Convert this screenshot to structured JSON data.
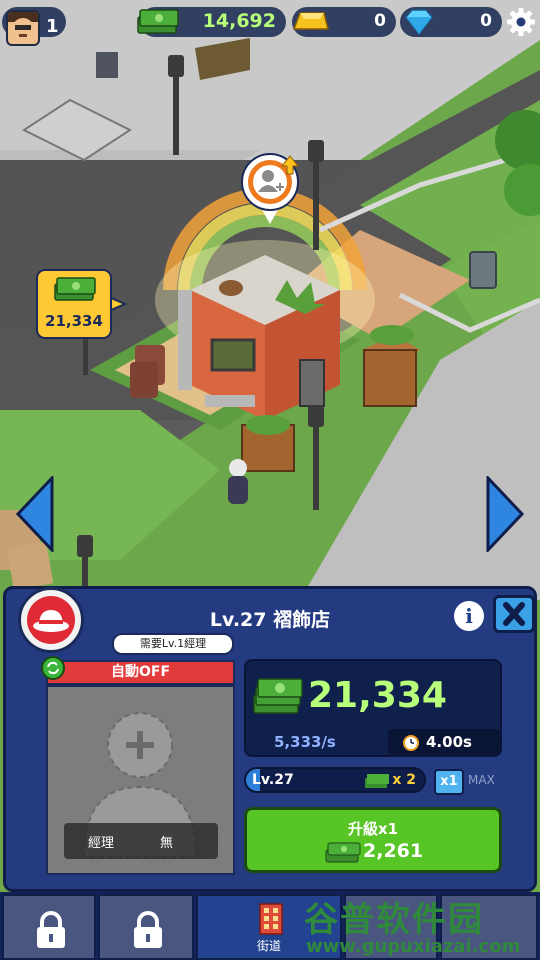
{
  "hud": {
    "player_level": "1",
    "cash": "14,692",
    "gold": "0",
    "diamonds": "0"
  },
  "scene": {
    "building_bubble_amount": "21,334"
  },
  "panel": {
    "title": "Lv.27 褶飾店",
    "manager_requirement": "需要Lv.1經理",
    "auto_status": "自動OFF",
    "manager_label": "經理",
    "manager_value": "無",
    "earnings": "21,334",
    "rate": "5,333/s",
    "cycle_time": "4.00s",
    "level_label": "Lv.27",
    "multiplier": "x 2",
    "buy_amount": "x1",
    "max_label": "MAX",
    "upgrade_label": "升級x1",
    "upgrade_cost": "2,261"
  },
  "nav": {
    "street_label": "街道"
  },
  "watermark": {
    "cn": "谷普软件园",
    "url": "www.gupuxiazai.com"
  }
}
